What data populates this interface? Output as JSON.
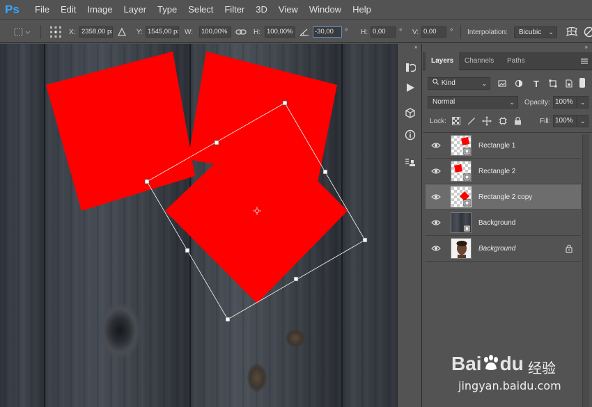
{
  "app": {
    "logo": "Ps"
  },
  "menu": [
    "File",
    "Edit",
    "Image",
    "Layer",
    "Type",
    "Select",
    "Filter",
    "3D",
    "View",
    "Window",
    "Help"
  ],
  "options": {
    "x_label": "X:",
    "x_value": "2358,00 px",
    "y_label": "Y:",
    "y_value": "1545,00 px",
    "w_label": "W:",
    "w_value": "100,00%",
    "h_label": "H:",
    "h_value": "100,00%",
    "angle_value": "-30,00",
    "hskew_label": "H:",
    "hskew_value": "0,00",
    "vskew_label": "V:",
    "vskew_value": "0,00",
    "degree_symbol": "°",
    "interpolation_label": "Interpolation:",
    "interpolation_value": "Bicubic"
  },
  "layers_panel": {
    "tabs": [
      "Layers",
      "Channels",
      "Paths"
    ],
    "filter_kind": "Kind",
    "blend_mode": "Normal",
    "opacity_label": "Opacity:",
    "opacity_value": "100%",
    "lock_label": "Lock:",
    "fill_label": "Fill:",
    "fill_value": "100%",
    "layers": [
      {
        "name": "Rectangle 1",
        "selected": false
      },
      {
        "name": "Rectangle 2",
        "selected": false
      },
      {
        "name": "Rectangle 2 copy",
        "selected": true
      },
      {
        "name": "Background",
        "selected": false
      },
      {
        "name": "Background",
        "selected": false,
        "italic": true,
        "locked": true
      }
    ]
  },
  "watermark": {
    "brand": "Bai",
    "brand_suffix": "du",
    "cn_text": "经验",
    "url": "jingyan.baidu.com"
  },
  "colors": {
    "accent_red": "#ff0000",
    "panel_bg": "#535353",
    "selection_blue": "#5d8fd7",
    "ps_blue": "#31a8ff"
  }
}
